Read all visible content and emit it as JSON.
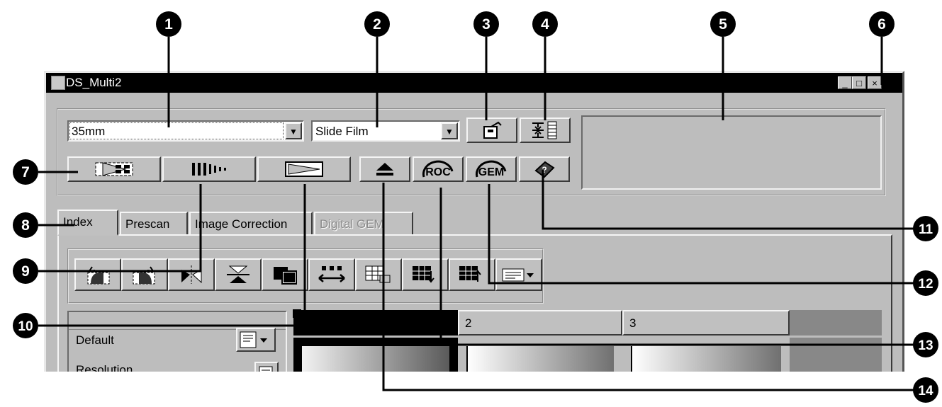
{
  "window": {
    "title": "DS_Multi2"
  },
  "window_controls": {
    "minimize": "_",
    "maximize": "□",
    "close": "×"
  },
  "combos": {
    "film_format": {
      "value": "35mm"
    },
    "film_type": {
      "value": "Slide Film"
    }
  },
  "tabs": [
    {
      "label": "Index",
      "active": true
    },
    {
      "label": "Prescan",
      "active": false
    },
    {
      "label": "Image Correction",
      "active": false
    },
    {
      "label": "Digital GEM",
      "active": false,
      "disabled": true
    }
  ],
  "buttons": {
    "roc": "ROC",
    "gem": "GEM"
  },
  "panel": {
    "default_label": "Default",
    "resolution_label": "Resolution"
  },
  "frames": {
    "headers": [
      "",
      "2",
      "3",
      ""
    ]
  },
  "callouts": [
    "1",
    "2",
    "3",
    "4",
    "5",
    "6",
    "7",
    "8",
    "9",
    "10",
    "11",
    "12",
    "13",
    "14"
  ],
  "colors": {
    "titlebar": "#000000",
    "window_bg": "#bdbdbd",
    "selected_frame": "#000000"
  }
}
